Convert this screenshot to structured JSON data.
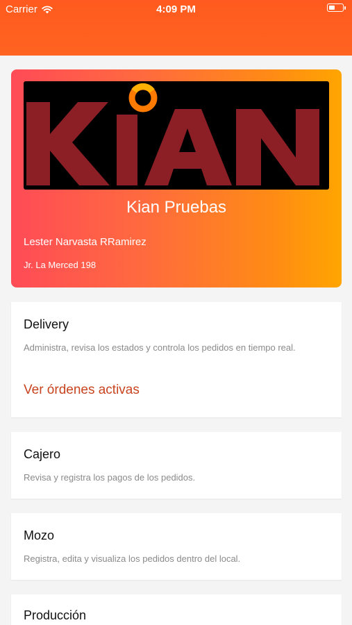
{
  "status": {
    "carrier": "Carrier",
    "time": "4:09 PM"
  },
  "hero": {
    "logo_text": "KIAN",
    "title": "Kian Pruebas",
    "owner": "Lester Narvasta RRamirez",
    "address": "Jr. La Merced 198"
  },
  "cards": [
    {
      "title": "Delivery",
      "description": "Administra, revisa los estados y controla los pedidos en tiempo real.",
      "link": "Ver órdenes activas"
    },
    {
      "title": "Cajero",
      "description": "Revisa y registra los pagos de los pedidos."
    },
    {
      "title": "Mozo",
      "description": "Registra, edita y visualiza los pedidos dentro del local."
    },
    {
      "title": "Producción"
    }
  ],
  "colors": {
    "header": "#ff5a1f",
    "accent": "#c8441f",
    "logo_red": "#8c1f26",
    "logo_orange": "#ff7a00"
  }
}
